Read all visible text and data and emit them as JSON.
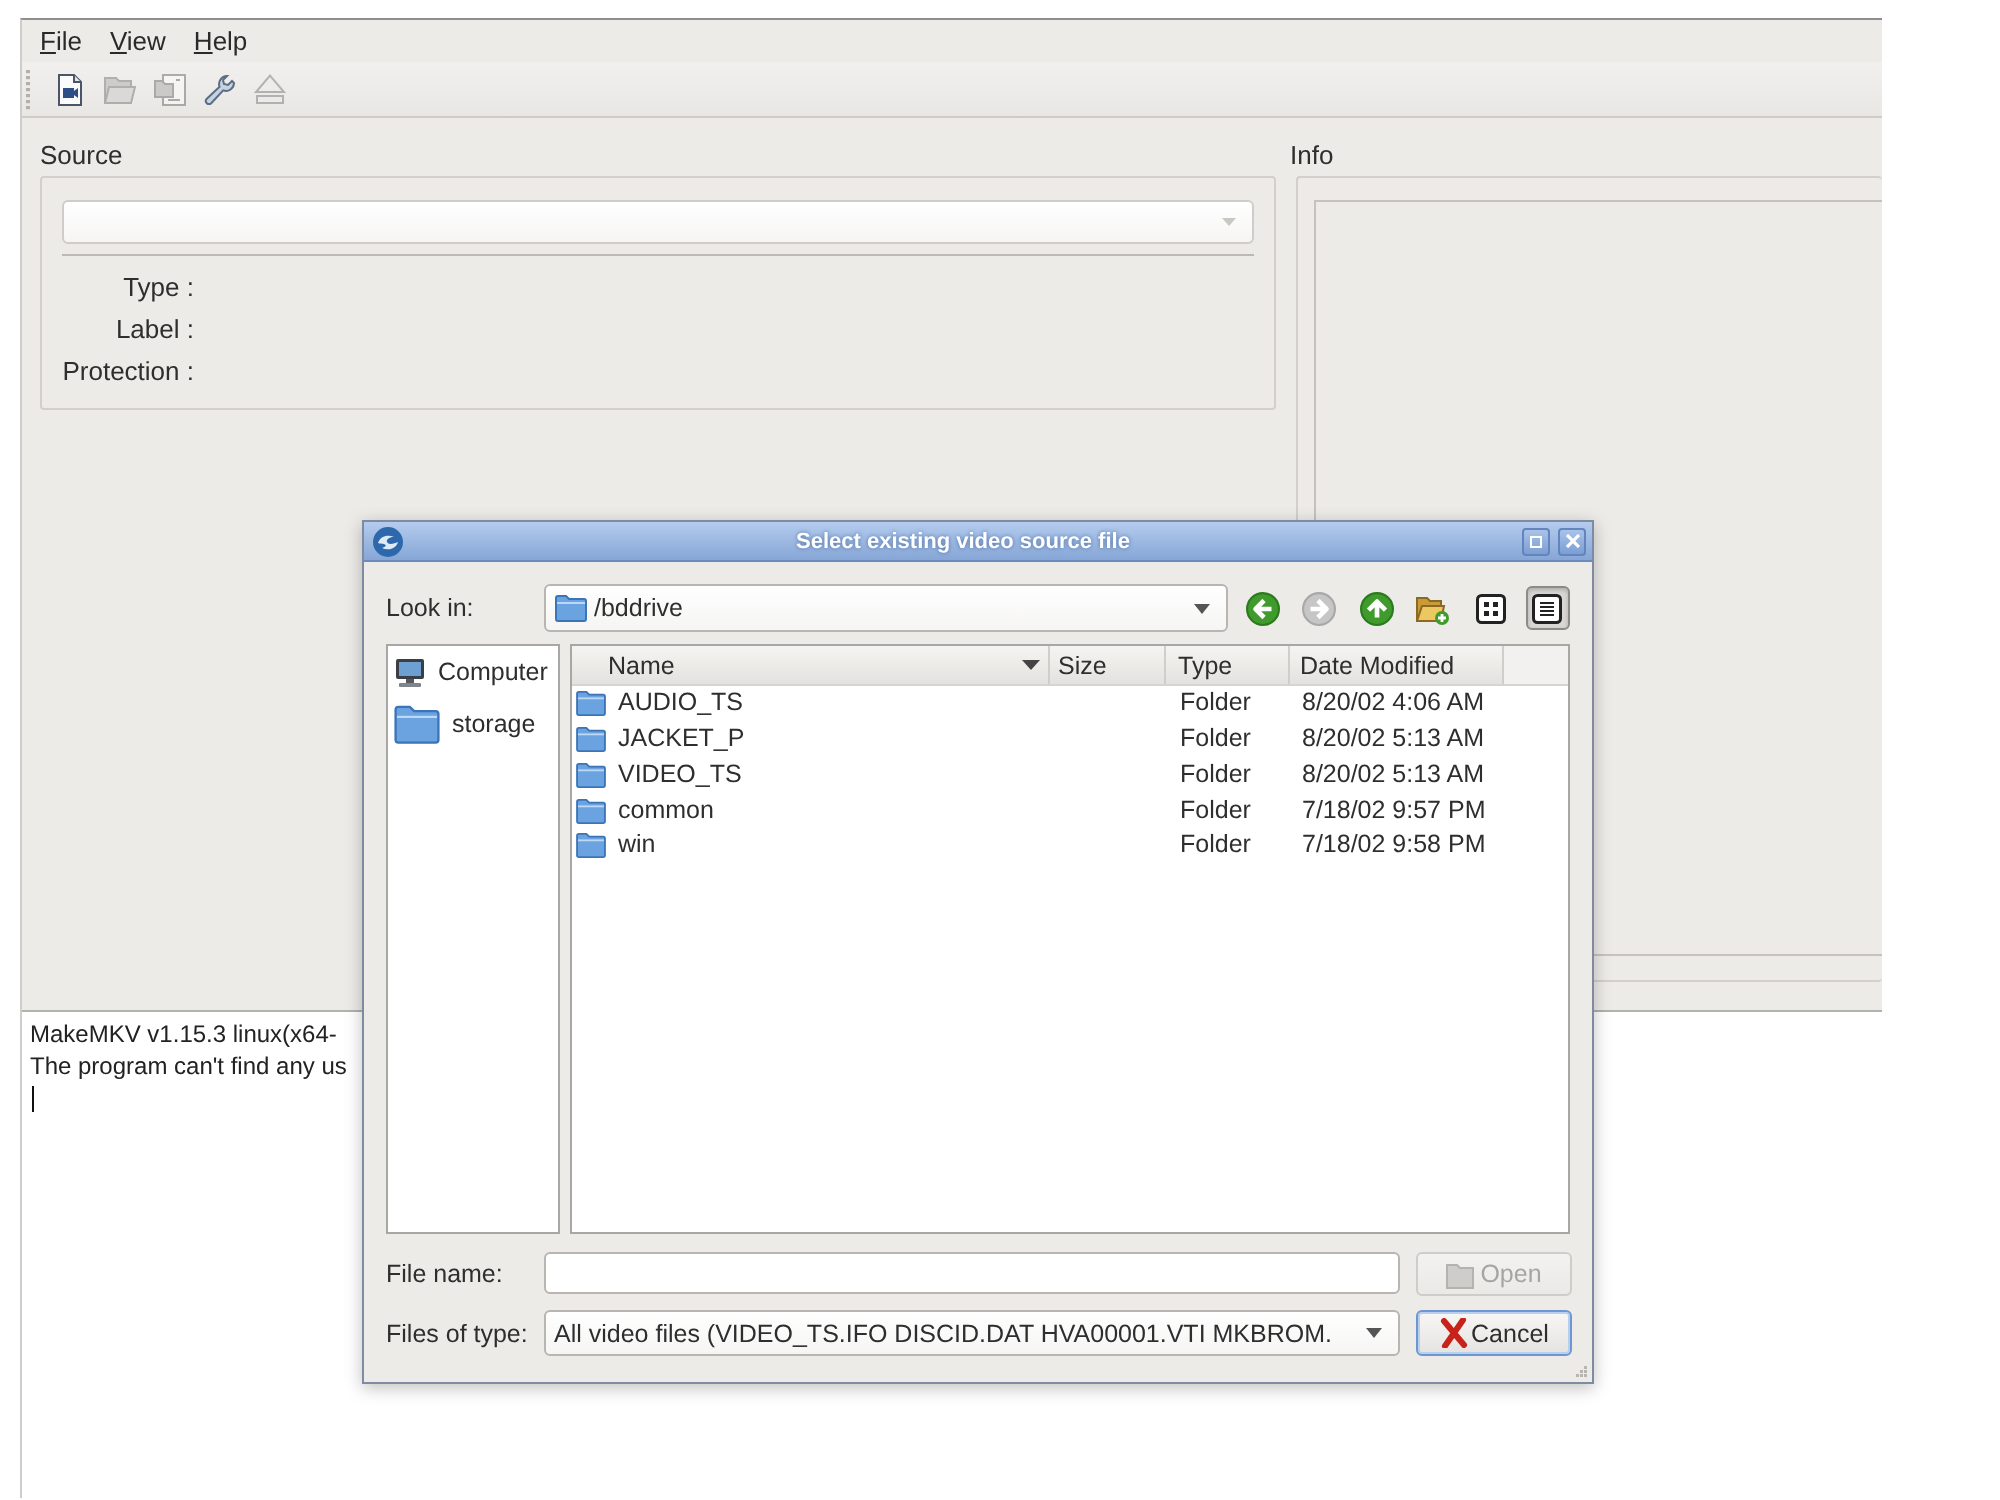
{
  "menu": [
    "File",
    "View",
    "Help"
  ],
  "toolbar": [
    {
      "kind": "file",
      "disabled": false
    },
    {
      "kind": "folder",
      "disabled": true
    },
    {
      "kind": "backup",
      "disabled": true
    },
    {
      "kind": "settings",
      "disabled": false
    },
    {
      "kind": "eject",
      "disabled": true
    }
  ],
  "source": {
    "title": "Source",
    "fields": [
      "Type :",
      "Label :",
      "Protection :"
    ]
  },
  "info": {
    "title": "Info"
  },
  "log": {
    "lines": [
      "MakeMKV v1.15.3 linux(x64-",
      "The program can't find any us"
    ]
  },
  "dialog": {
    "title": "Select existing video source file",
    "look_in": {
      "label": "Look in:",
      "value": "/bddrive"
    },
    "nav_buttons": [
      {
        "kind": "back",
        "disabled": false
      },
      {
        "kind": "forward",
        "disabled": true
      },
      {
        "kind": "up",
        "disabled": false
      },
      {
        "kind": "new_folder",
        "disabled": false
      }
    ],
    "view_modes": [
      {
        "kind": "icons",
        "selected": false
      },
      {
        "kind": "details",
        "selected": true
      }
    ],
    "places": [
      {
        "kind": "computer",
        "label": "Computer"
      },
      {
        "kind": "folder",
        "label": "storage"
      }
    ],
    "columns": [
      {
        "label": "Name",
        "sorted": true
      },
      {
        "label": "Size",
        "sorted": false
      },
      {
        "label": "Type",
        "sorted": false
      },
      {
        "label": "Date Modified",
        "sorted": false
      }
    ],
    "rows": [
      {
        "name": "AUDIO_TS",
        "type": "Folder",
        "modified": "8/20/02 4:06 AM"
      },
      {
        "name": "JACKET_P",
        "type": "Folder",
        "modified": "8/20/02 5:13 AM"
      },
      {
        "name": "VIDEO_TS",
        "type": "Folder",
        "modified": "8/20/02 5:13 AM"
      },
      {
        "name": "common",
        "type": "Folder",
        "modified": "7/18/02 9:57 PM"
      },
      {
        "name": "win",
        "type": "Folder",
        "modified": "7/18/02 9:58 PM"
      }
    ],
    "file_name": {
      "label": "File name:"
    },
    "file_type": {
      "label": "Files of type:",
      "value": "All video files (VIDEO_TS.IFO DISCID.DAT HVA00001.VTI MKBROM."
    },
    "buttons": [
      {
        "kind": "open",
        "label": "Open",
        "disabled": true,
        "focused": false
      },
      {
        "kind": "cancel",
        "label": "Cancel",
        "disabled": false,
        "focused": true
      }
    ]
  }
}
